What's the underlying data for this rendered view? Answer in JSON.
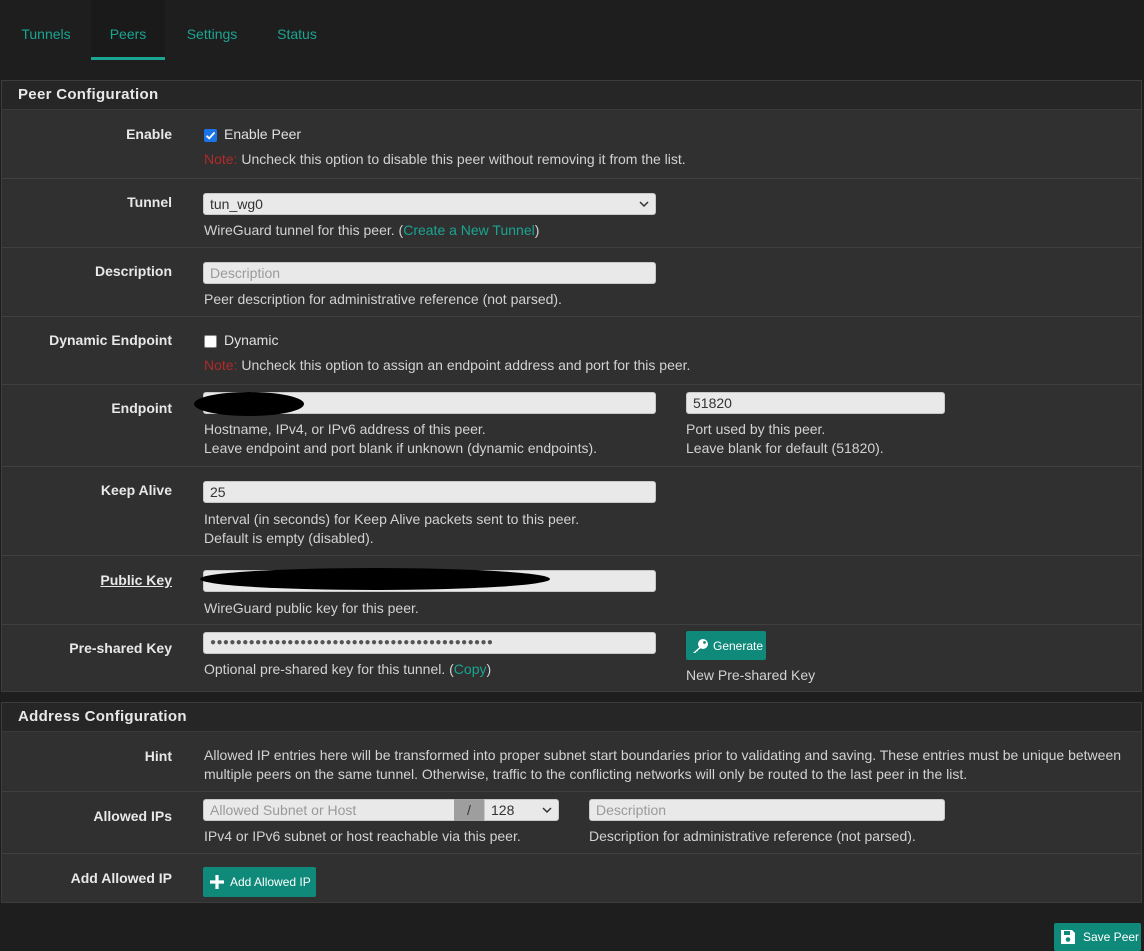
{
  "tabs": [
    "Tunnels",
    "Peers",
    "Settings",
    "Status"
  ],
  "peer_section": {
    "title": "Peer Configuration"
  },
  "enable": {
    "label": "Enable",
    "checkbox_label": "Enable Peer",
    "checked": true,
    "note_prefix": "Note:",
    "note_text": " Uncheck this option to disable this peer without removing it from the list."
  },
  "tunnel": {
    "label": "Tunnel",
    "selected": "tun_wg0",
    "help_prefix": "WireGuard tunnel for this peer. (",
    "help_link": "Create a New Tunnel",
    "help_suffix": ")"
  },
  "description": {
    "label": "Description",
    "placeholder": "Description",
    "help": "Peer description for administrative reference (not parsed)."
  },
  "dynamic_endpoint": {
    "label": "Dynamic Endpoint",
    "checkbox_label": "Dynamic",
    "checked": false,
    "note_prefix": "Note:",
    "note_text": " Uncheck this option to assign an endpoint address and port for this peer."
  },
  "endpoint": {
    "label": "Endpoint",
    "help_line1": "Hostname, IPv4, or IPv6 address of this peer.",
    "help_line2": "Leave endpoint and port blank if unknown (dynamic endpoints).",
    "port_value": "51820",
    "port_help_line1": "Port used by this peer.",
    "port_help_line2": "Leave blank for default (51820)."
  },
  "keep_alive": {
    "label": "Keep Alive",
    "value": "25",
    "help_line1": "Interval (in seconds) for Keep Alive packets sent to this peer.",
    "help_line2": "Default is empty (disabled)."
  },
  "public_key": {
    "label": "Public Key",
    "help": "WireGuard public key for this peer."
  },
  "preshared_key": {
    "label": "Pre-shared Key",
    "masked_value": "●●●●●●●●●●●●●●●●●●●●●●●●●●●●●●●●●●●●●●●●●●●●",
    "help_prefix": "Optional pre-shared key for this tunnel. (",
    "help_link": "Copy",
    "help_suffix": ")",
    "generate_button": "Generate",
    "generate_help": "New Pre-shared Key",
    "icon": "key-icon"
  },
  "address_section": {
    "title": "Address Configuration"
  },
  "hint": {
    "label": "Hint",
    "line1": "Allowed IP entries here will be transformed into proper subnet start boundaries prior to validating and saving. These entries must be unique between",
    "line2": "multiple peers on the same tunnel. Otherwise, traffic to the conflicting networks will only be routed to the last peer in the list."
  },
  "allowed_ips": {
    "label": "Allowed IPs",
    "subnet_placeholder": "Allowed Subnet or Host",
    "slash": "/",
    "mask_value": "128",
    "description_placeholder": "Description",
    "help": "IPv4 or IPv6 subnet or host reachable via this peer.",
    "description_help": "Description for administrative reference (not parsed)."
  },
  "add_allowed_ip": {
    "label": "Add Allowed IP",
    "button": "Add Allowed IP",
    "icon": "plus-icon"
  },
  "save_button": {
    "label": "Save Peer",
    "icon": "save-icon"
  },
  "colors": {
    "accent": "#1aa591",
    "button": "#0f8a7a",
    "note": "#b02a2a",
    "checkbox": "#1a73e8"
  }
}
